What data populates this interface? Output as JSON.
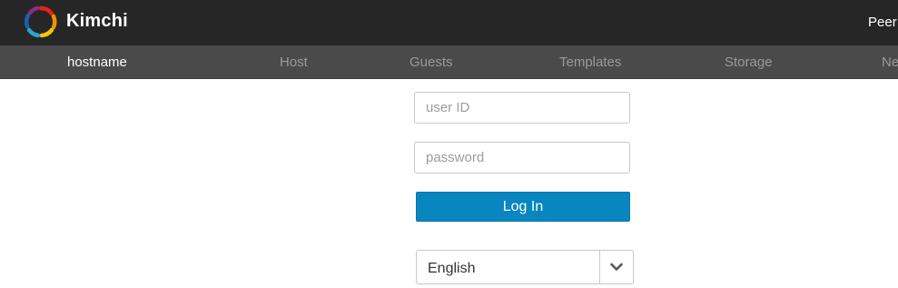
{
  "app": {
    "brand": "Kimchi",
    "peers_label": "Peer"
  },
  "nav": {
    "items": [
      {
        "label": "hostname",
        "active": true
      },
      {
        "label": "Host",
        "active": false
      },
      {
        "label": "Guests",
        "active": false
      },
      {
        "label": "Templates",
        "active": false
      },
      {
        "label": "Storage",
        "active": false
      },
      {
        "label": "Ne",
        "active": false
      }
    ]
  },
  "login": {
    "user_placeholder": "user ID",
    "user_value": "",
    "password_placeholder": "password",
    "password_value": "",
    "login_label": "Log In"
  },
  "language": {
    "selected": "English"
  },
  "colors": {
    "topbar": "#262626",
    "navbar": "#4a4a4a",
    "button": "#0886bf"
  },
  "icons": {
    "logo": "kimchi-logo-icon",
    "dropdown": "chevron-down-icon"
  }
}
